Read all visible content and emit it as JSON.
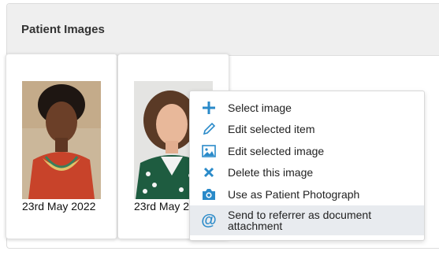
{
  "panel": {
    "title": "Patient Images"
  },
  "images": [
    {
      "date": "23rd May 2022"
    },
    {
      "date": "23rd May 2022"
    }
  ],
  "context_menu": {
    "items": [
      {
        "label": "Select image",
        "icon": "plus-icon"
      },
      {
        "label": "Edit selected item",
        "icon": "pencil-icon"
      },
      {
        "label": "Edit selected image",
        "icon": "image-icon"
      },
      {
        "label": "Delete this image",
        "icon": "close-icon"
      },
      {
        "label": "Use as Patient Photograph",
        "icon": "camera-icon"
      },
      {
        "label": "Send to referrer as document attachment",
        "icon": "at-icon"
      }
    ]
  },
  "colors": {
    "accent": "#2a8ac9",
    "header_bg": "#efefef",
    "highlight": "#e8ebef"
  }
}
